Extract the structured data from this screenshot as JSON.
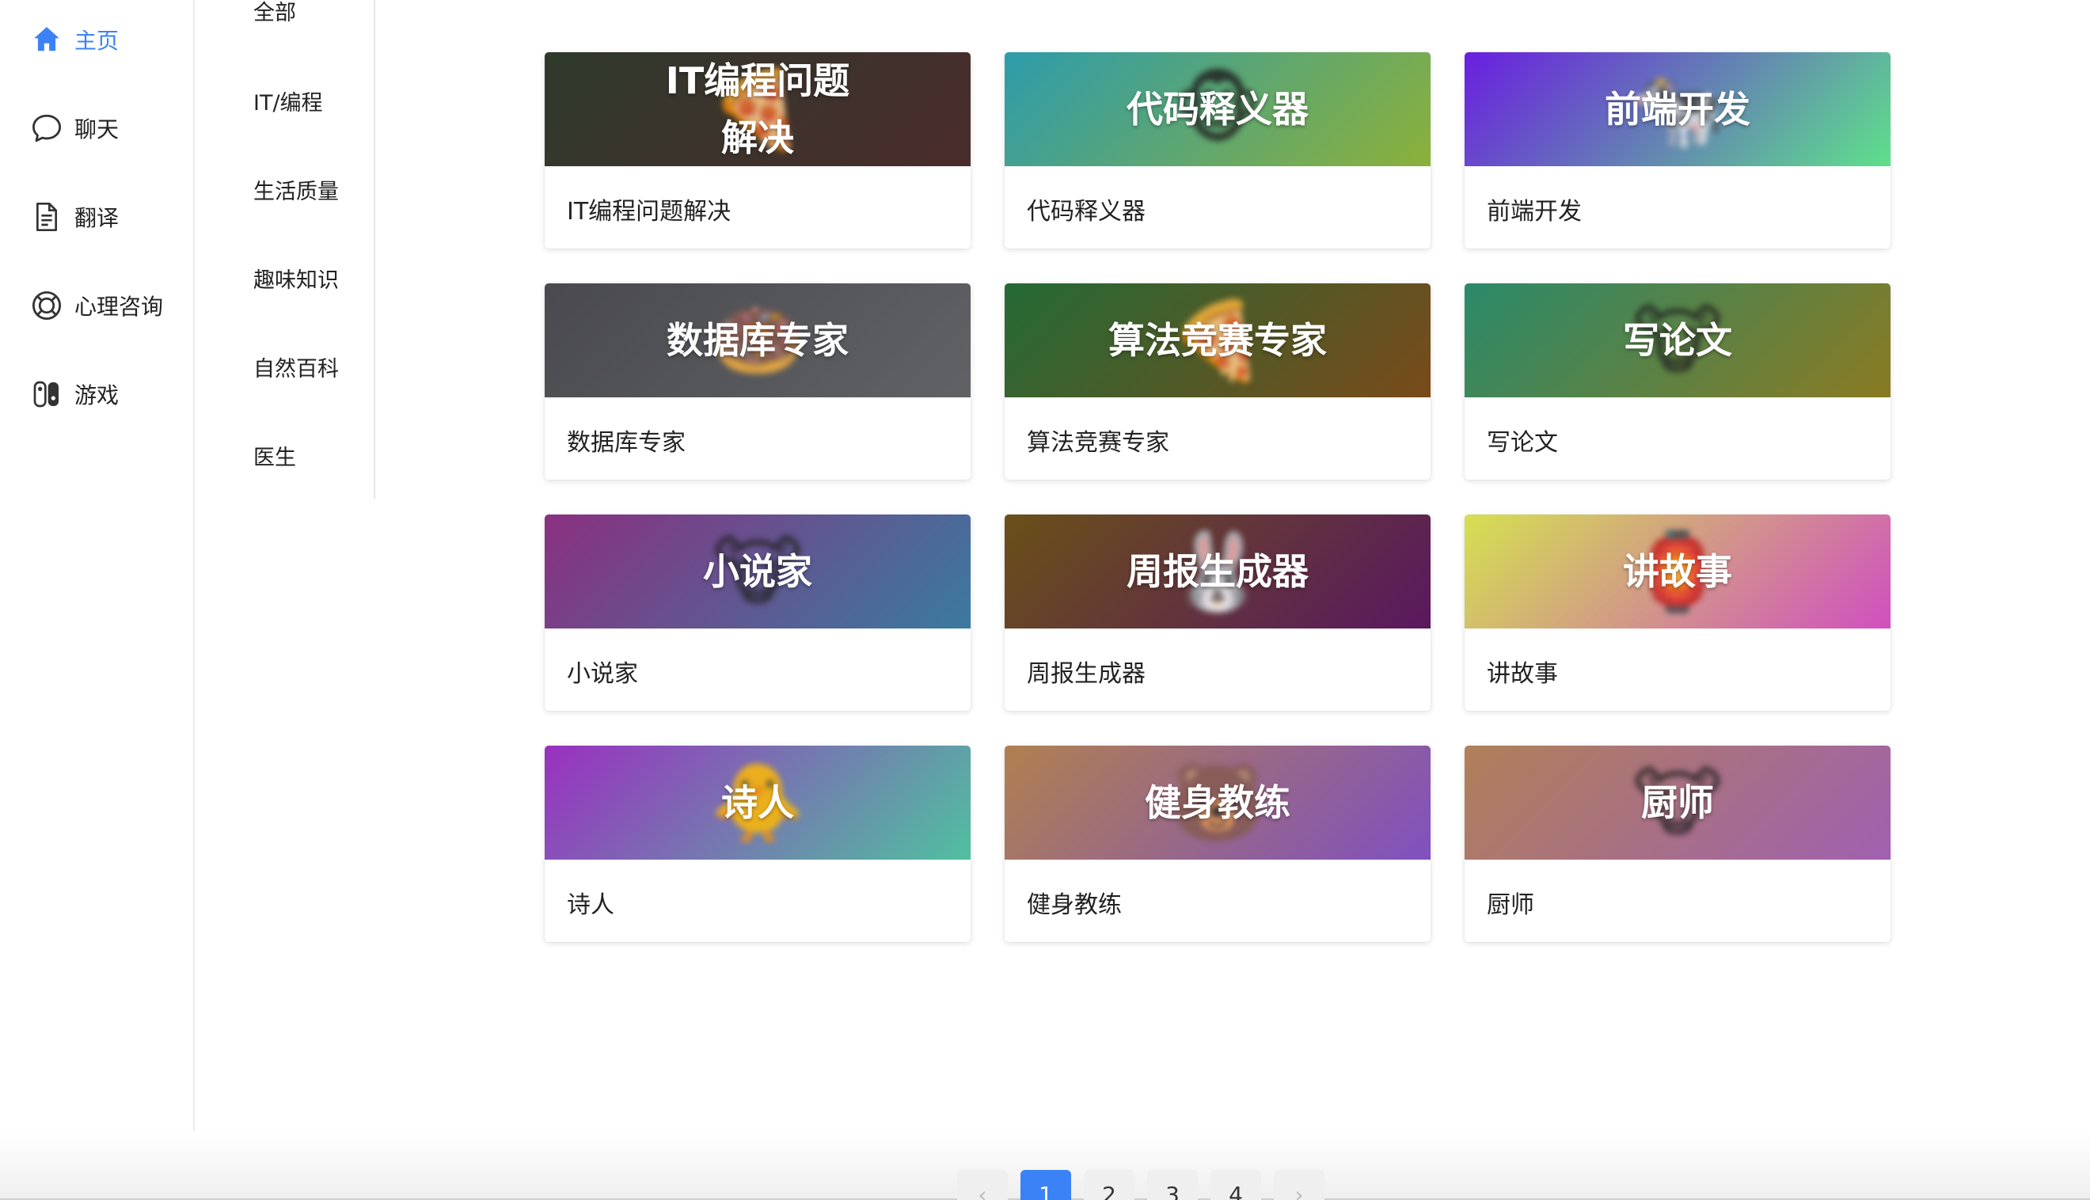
{
  "nav": {
    "items": [
      {
        "label": "主页",
        "icon": "home-icon",
        "active": true
      },
      {
        "label": "聊天",
        "icon": "chat-bubble-icon"
      },
      {
        "label": "翻译",
        "icon": "document-icon"
      },
      {
        "label": "心理咨询",
        "icon": "lifebuoy-icon"
      },
      {
        "label": "游戏",
        "icon": "game-controller-icon"
      }
    ]
  },
  "categories": [
    "全部",
    "IT/编程",
    "生活质量",
    "趣味知识",
    "自然百科",
    "医生"
  ],
  "cards": [
    {
      "title": "IT编程问题解决",
      "name": "IT编程问题解决",
      "emoji": "🍕"
    },
    {
      "title": "代码释义器",
      "name": "代码释义器",
      "emoji": "🐵"
    },
    {
      "title": "前端开发",
      "name": "前端开发",
      "emoji": "🐄"
    },
    {
      "title": "数据库专家",
      "name": "数据库专家",
      "emoji": "🍩"
    },
    {
      "title": "算法竞赛专家",
      "name": "算法竞赛专家",
      "emoji": "🍕"
    },
    {
      "title": "写论文",
      "name": "写论文",
      "emoji": "🐮"
    },
    {
      "title": "小说家",
      "name": "小说家",
      "emoji": "🐮"
    },
    {
      "title": "周报生成器",
      "name": "周报生成器",
      "emoji": "🐰"
    },
    {
      "title": "讲故事",
      "name": "讲故事",
      "emoji": "🏮"
    },
    {
      "title": "诗人",
      "name": "诗人",
      "emoji": "🐥"
    },
    {
      "title": "健身教练",
      "name": "健身教练",
      "emoji": "🐻"
    },
    {
      "title": "厨师",
      "name": "厨师",
      "emoji": "🐮"
    }
  ],
  "colors": {
    "accent": "#3b82f6",
    "banners": [
      [
        "#2f3a2c",
        "#4a2c2c"
      ],
      [
        "#2e9cab",
        "#8cb03a"
      ],
      [
        "#6a1ee0",
        "#5ee08a"
      ],
      [
        "#4a4a4e",
        "#606266"
      ],
      [
        "#246a35",
        "#7a4a1a"
      ],
      [
        "#2a8a6a",
        "#8a7a22"
      ],
      [
        "#8a3080",
        "#3a7aa0"
      ],
      [
        "#6a5018",
        "#5a1860"
      ],
      [
        "#d4e050",
        "#d050c0"
      ],
      [
        "#9a30c0",
        "#50c0a0"
      ],
      [
        "#b08050",
        "#8050c0"
      ],
      [
        "#b08058",
        "#a060b0"
      ]
    ]
  },
  "pagination": {
    "prev": "‹",
    "next": "›",
    "pages": [
      "1",
      "2",
      "3",
      "4"
    ],
    "current": "1"
  }
}
